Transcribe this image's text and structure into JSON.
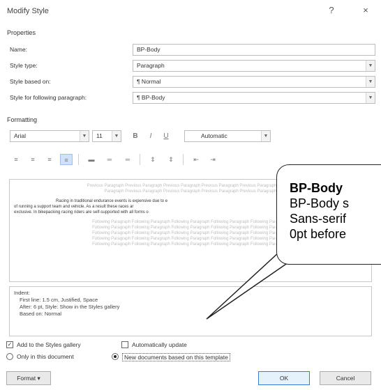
{
  "dialog": {
    "title": "Modify Style",
    "help_glyph": "?",
    "close_glyph": "×"
  },
  "properties": {
    "section_label": "Properties",
    "name_label": "Name:",
    "name_value": "BP-Body",
    "style_type_label": "Style type:",
    "style_type_value": "Paragraph",
    "based_on_label": "Style based on:",
    "based_on_value": "¶ Normal",
    "following_label": "Style for following paragraph:",
    "following_value": "¶ BP-Body"
  },
  "formatting": {
    "section_label": "Formatting",
    "font_value": "Arial",
    "size_value": "11",
    "bold": "B",
    "italic": "I",
    "underline": "U",
    "color_value": "Automatic"
  },
  "preview": {
    "prev_para": "Previous Paragraph Previous Paragraph Previous Paragraph Previous Paragraph Previous Paragraph Previous",
    "prev_para_2": "Paragraph Previous Paragraph Previous Paragraph Previous Paragraph Previous Paragraph",
    "body_1": "Racing in traditional endurance events is expensive due to e",
    "body_2": "of running a support team and vehicle. As a result these races ar",
    "body_3": "exclusive. In bikepacking racing riders are self-supported with all forms o",
    "follow_para": "Following Paragraph Following Paragraph Following Paragraph Following Paragraph Following Paragraph"
  },
  "description": {
    "line1": "Indent:",
    "line2": "First line:  1.5 cm, Justified, Space",
    "line3": "After:  6 pt, Style: Show in the Styles gallery",
    "line4": "Based on: Normal"
  },
  "options": {
    "add_gallery_label": "Add to the Styles gallery",
    "auto_update_label": "Automatically update",
    "only_doc_label": "Only in this document",
    "new_docs_label": "New documents based on this template"
  },
  "buttons": {
    "format_label": "Format ▾",
    "ok_label": "OK",
    "cancel_label": "Cancel"
  },
  "callout": {
    "title": "BP-Body",
    "line1": "BP-Body s",
    "line2": "Sans-serif",
    "line3": "0pt before"
  },
  "colors": {
    "accent": "#3a7bd5",
    "selected_toolbar": "#cfe2f7"
  }
}
